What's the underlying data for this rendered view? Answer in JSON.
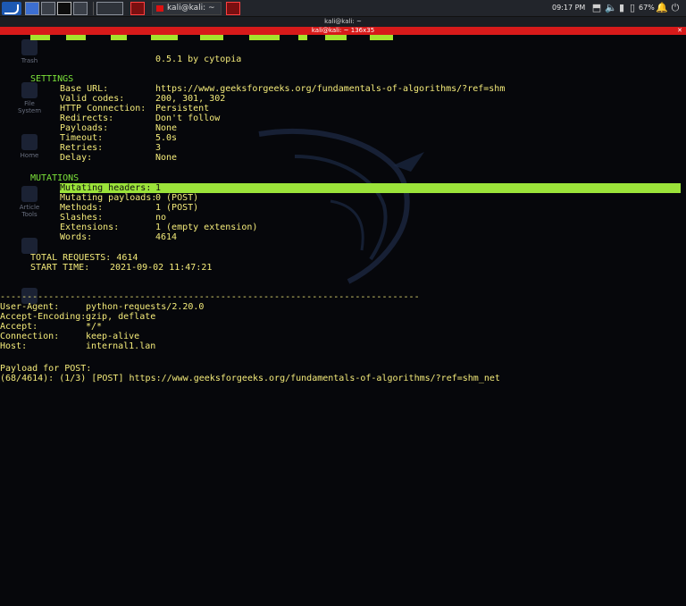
{
  "taskbar": {
    "window_task_label": "kali@kali: ~",
    "clock": "09:17 PM",
    "battery_percent": "67%"
  },
  "window": {
    "desktop_title": "kali@kali: ~",
    "terminal_title": "kali@kali: ~ 136x35"
  },
  "desktop_icons": [
    "Trash",
    "File System",
    "Home",
    "Article Tools",
    "",
    ""
  ],
  "terminal": {
    "version": "0.5.1 by cytopia",
    "settings_header": "SETTINGS",
    "settings": [
      {
        "key": "Base URL:",
        "value": "https://www.geeksforgeeks.org/fundamentals-of-algorithms/?ref=shm"
      },
      {
        "key": "Valid codes:",
        "value": "200, 301, 302"
      },
      {
        "key": "HTTP Connection:",
        "value": "Persistent"
      },
      {
        "key": "Redirects:",
        "value": "Don't follow"
      },
      {
        "key": "Payloads:",
        "value": "None"
      },
      {
        "key": "Timeout:",
        "value": "5.0s"
      },
      {
        "key": "Retries:",
        "value": "3"
      },
      {
        "key": "Delay:",
        "value": "None"
      }
    ],
    "mutations_header": "MUTATIONS",
    "mutations": [
      {
        "key": "Mutating headers:",
        "value": "1"
      },
      {
        "key": "Mutating payloads:",
        "value": "0 (POST)"
      },
      {
        "key": "Methods:",
        "value": "1 (POST)"
      },
      {
        "key": "Slashes:",
        "value": "no"
      },
      {
        "key": "Extensions:",
        "value": "1 (empty extension)"
      },
      {
        "key": "Words:",
        "value": "4614"
      }
    ],
    "total_requests": "TOTAL REQUESTS: 4614",
    "start_time_label": "START TIME:",
    "start_time": "2021-09-02 11:47:21",
    "divider": "------------------------------------------------------------------------------",
    "headers": [
      {
        "key": "User-Agent:",
        "value": "python-requests/2.20.0"
      },
      {
        "key": "Accept-Encoding:",
        "value": "gzip, deflate"
      },
      {
        "key": "Accept:",
        "value": "*/*"
      },
      {
        "key": "Connection:",
        "value": "keep-alive"
      },
      {
        "key": "Host:",
        "value": "internal1.lan"
      }
    ],
    "payload_label": "Payload for POST:",
    "progress_line": "(68/4614): (1/3) [POST] https://www.geeksforgeeks.org/fundamentals-of-algorithms/?ref=shm_net"
  }
}
